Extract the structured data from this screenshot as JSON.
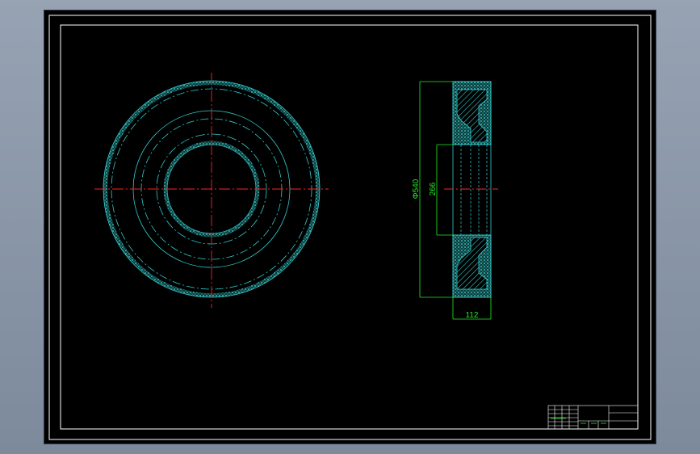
{
  "drawing": {
    "dimensions": {
      "outer_diameter": "Φ540",
      "inner_diameter": "266",
      "width": "112"
    }
  },
  "colors": {
    "background": "#000000",
    "border": "#ffffff",
    "outline": "#33cccc",
    "centerline": "#ff2222",
    "dimension": "#22ee22"
  }
}
